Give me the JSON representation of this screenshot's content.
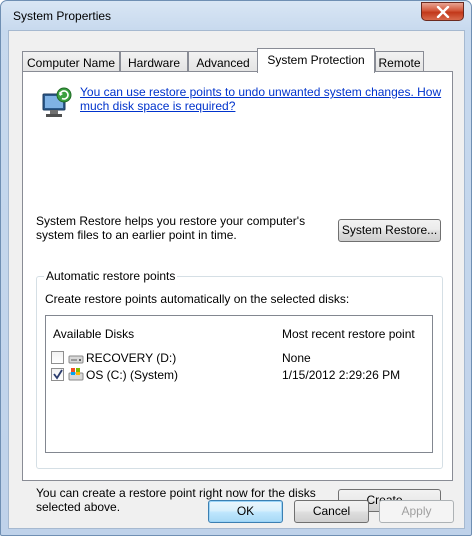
{
  "window": {
    "title": "System Properties"
  },
  "tabs": [
    {
      "label": "Computer Name"
    },
    {
      "label": "Hardware"
    },
    {
      "label": "Advanced"
    },
    {
      "label": "System Protection",
      "active": true
    },
    {
      "label": "Remote"
    }
  ],
  "protection": {
    "info_link": "You can use restore points to undo unwanted system changes. How much disk space is required?",
    "restore_description": "System Restore helps you restore your computer's system files to an earlier point in time.",
    "system_restore_button": "System Restore..."
  },
  "restore_points": {
    "group_label": "Automatic restore points",
    "instruction": "Create restore points automatically on the selected disks:",
    "columns": {
      "disk": "Available Disks",
      "recent": "Most recent restore point"
    },
    "disks": [
      {
        "name": "RECOVERY (D:)",
        "recent": "None",
        "checked": false,
        "icon": "drive-icon"
      },
      {
        "name": "OS (C:) (System)",
        "recent": "1/15/2012 2:29:26 PM",
        "checked": true,
        "icon": "system-drive-icon"
      }
    ]
  },
  "create": {
    "description": "You can create a restore point right now for the disks selected above.",
    "button": "Create..."
  },
  "footer": {
    "ok": "OK",
    "cancel": "Cancel",
    "apply": "Apply"
  },
  "colors": {
    "link": "#0033cc",
    "close_button": "#c2381a",
    "frame": "#c7d9ee"
  }
}
